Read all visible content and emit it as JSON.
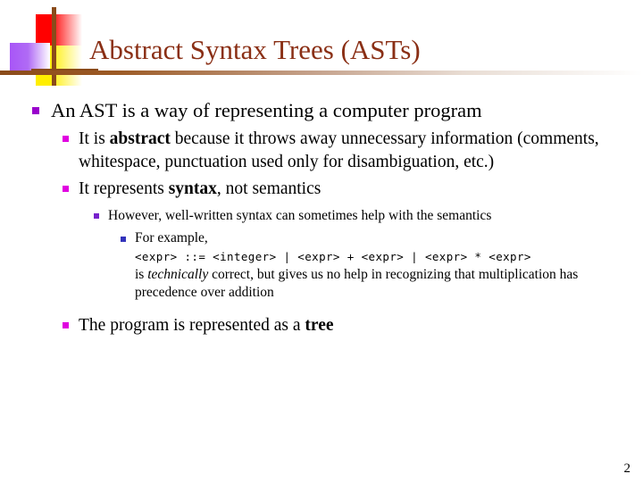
{
  "slide": {
    "title": "Abstract Syntax Trees (ASTs)",
    "page_number": "2",
    "colors": {
      "title_text": "#8a2f15",
      "rule": "#8a4b1a",
      "deco_red": "#ff0000",
      "deco_yellow": "#ffee00",
      "deco_purple": "#a855f7",
      "deco_line": "#8a4b1a",
      "bullet_level1": "#9900cc",
      "bullet_level2": "#e000e0",
      "bullet_level3": "#7722cc",
      "bullet_level4": "#3333bb",
      "body_text": "#000000"
    }
  },
  "content": {
    "b1": {
      "text": "An AST is a way of representing a computer program"
    },
    "b2": {
      "pre": "It is ",
      "bold": "abstract",
      "post": " because it throws away unnecessary information (comments, whitespace, punctuation used only for disambiguation, etc.)"
    },
    "b3": {
      "pre": "It represents ",
      "bold": "syntax",
      "post": ", not semantics"
    },
    "b4": {
      "text": "However, well-written syntax can sometimes help with the semantics"
    },
    "b5": {
      "text": "For example,",
      "code": "<expr> ::= <integer> | <expr> + <expr> | <expr> * <expr>",
      "follow_pre": "is ",
      "follow_italic": "technically",
      "follow_post": " correct, but gives us no help in recognizing that multiplication has precedence over addition"
    },
    "b6": {
      "pre": "The program is represented as a ",
      "bold": "tree",
      "post": ""
    }
  }
}
